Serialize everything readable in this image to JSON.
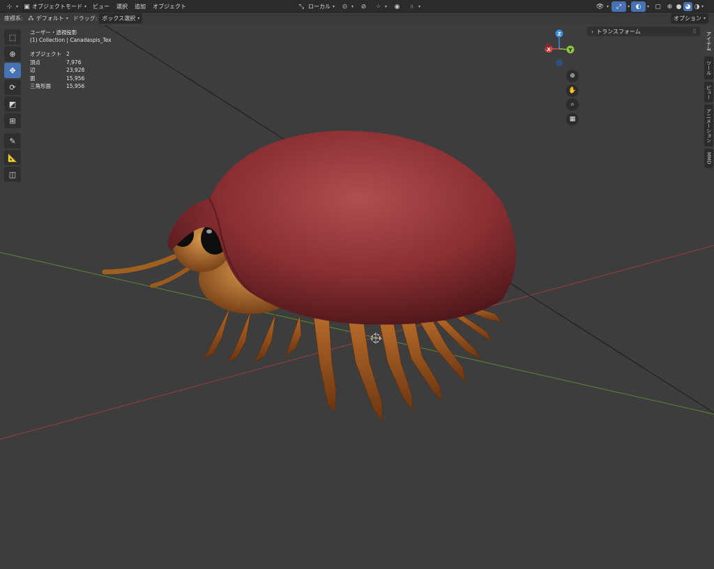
{
  "header": {
    "mode_label": "オブジェクトモード",
    "menus": [
      "ビュー",
      "選択",
      "追加",
      "オブジェクト"
    ],
    "transform_orientation": "ローカル"
  },
  "subheader": {
    "coord_label": "座標系:",
    "coord_value": "デフォルト",
    "drag_label": "ドラッグ:",
    "drag_value": "ボックス選択",
    "options_label": "オプション"
  },
  "viewport": {
    "view_name": "ユーザー・透視投影",
    "collection_line": "(1) Collection | Canadaspis_Tex",
    "stats": [
      {
        "key": "オブジェクト",
        "value": "2"
      },
      {
        "key": "頂点",
        "value": "7,976"
      },
      {
        "key": "辺",
        "value": "23,928"
      },
      {
        "key": "面",
        "value": "15,956"
      },
      {
        "key": "三角形面",
        "value": "15,956"
      }
    ],
    "gizmo": {
      "x": "X",
      "y": "Y",
      "z": "Z"
    }
  },
  "sidebar": {
    "panel_title": "トランスフォーム",
    "tabs": [
      "アイテム",
      "ツール",
      "ビュー",
      "アニメーション",
      "MMD"
    ]
  },
  "colors": {
    "accent": "#4772b3",
    "axis_x": "#e0474c",
    "axis_y": "#8cc63f",
    "axis_z": "#3b8de4"
  }
}
